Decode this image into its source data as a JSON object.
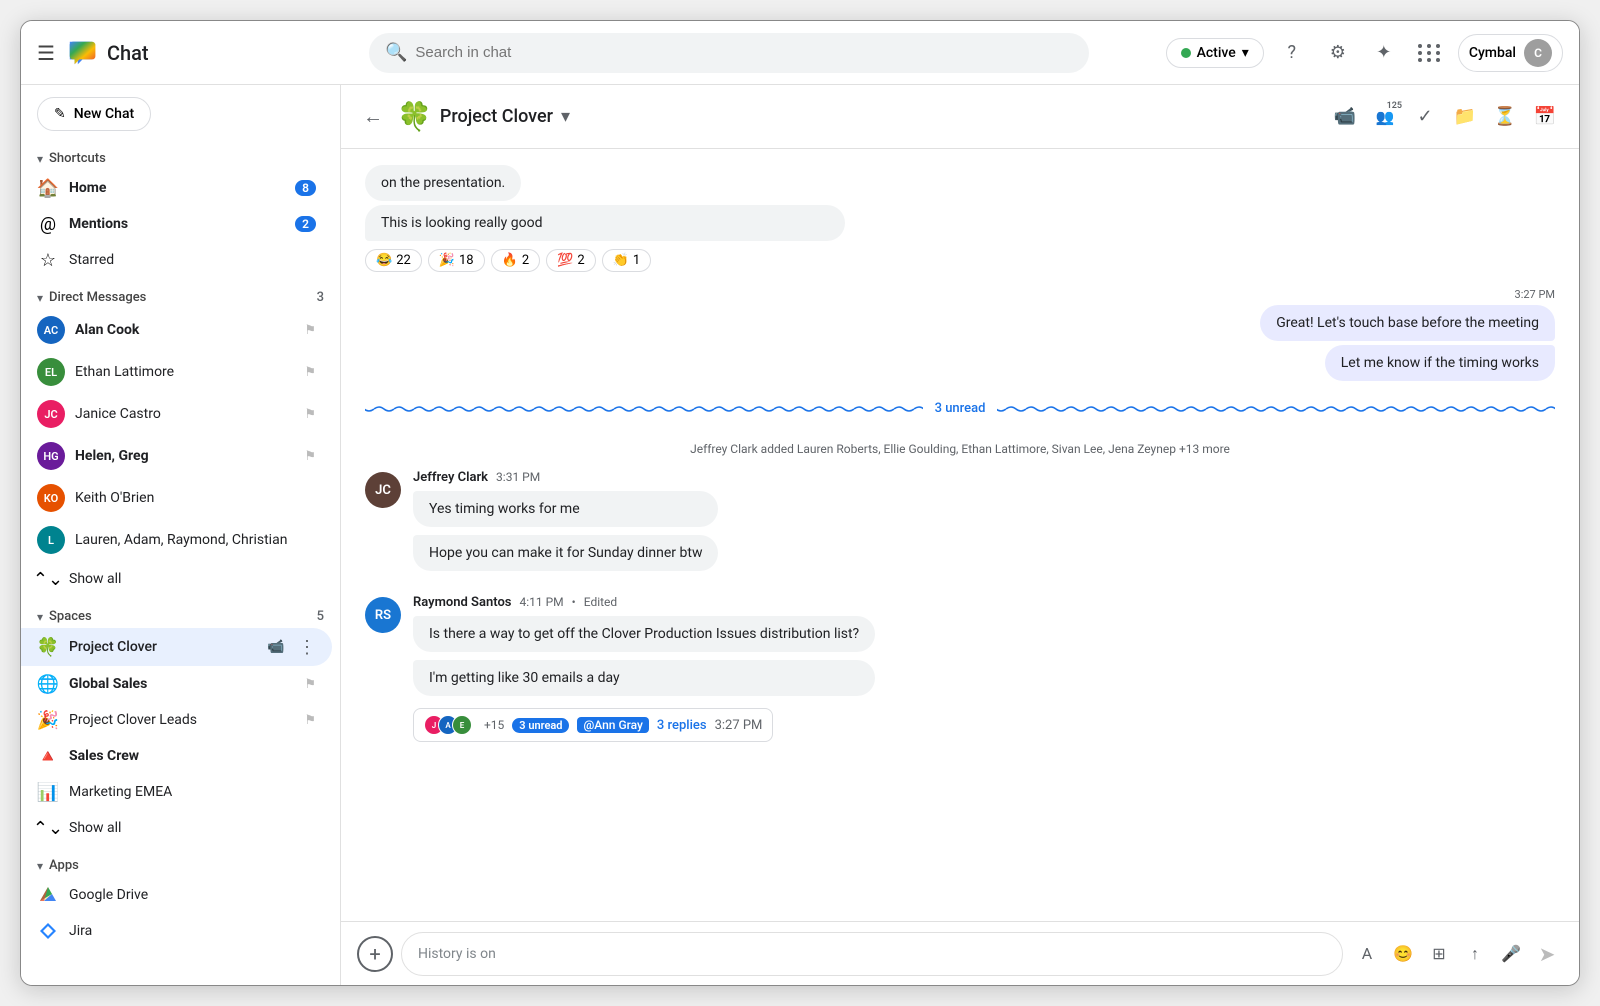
{
  "app": {
    "title": "Chat",
    "search_placeholder": "Search in chat"
  },
  "topbar": {
    "active_label": "Active",
    "user_name": "Cymbal"
  },
  "sidebar": {
    "new_chat_label": "New Chat",
    "shortcuts_label": "Shortcuts",
    "home_label": "Home",
    "home_badge": "8",
    "mentions_label": "Mentions",
    "mentions_badge": "2",
    "starred_label": "Starred",
    "dm_section": "Direct Messages",
    "dm_count": "3",
    "dm_items": [
      {
        "label": "Alan Cook",
        "bold": true,
        "avatar_initials": "AC",
        "avatar_class": "avatar-al"
      },
      {
        "label": "Ethan Lattimore",
        "bold": false,
        "avatar_initials": "EL",
        "avatar_class": "avatar-el"
      },
      {
        "label": "Janice Castro",
        "bold": false,
        "avatar_initials": "JC",
        "avatar_class": "avatar-jc"
      },
      {
        "label": "Helen, Greg",
        "bold": true,
        "avatar_initials": "HG",
        "avatar_class": "avatar-hg"
      },
      {
        "label": "Keith O'Brien",
        "bold": false,
        "avatar_initials": "KO",
        "avatar_class": "avatar-ko"
      },
      {
        "label": "Lauren, Adam, Raymond, Christian",
        "bold": false,
        "avatar_initials": "L",
        "avatar_class": "avatar-la"
      }
    ],
    "show_all_dm": "Show all",
    "spaces_section": "Spaces",
    "spaces_count": "5",
    "spaces_items": [
      {
        "label": "Project Clover",
        "active": true,
        "emoji": "🍀",
        "avatar_class": "avatar-pc"
      },
      {
        "label": "Global Sales",
        "bold": true,
        "emoji": "🌐",
        "avatar_class": "avatar-gs"
      },
      {
        "label": "Project Clover Leads",
        "bold": false,
        "emoji": "🎉",
        "avatar_class": "avatar-pc"
      },
      {
        "label": "Sales Crew",
        "bold": false,
        "emoji": "🔺",
        "avatar_class": ""
      },
      {
        "label": "Marketing EMEA",
        "bold": false,
        "emoji": "📊",
        "avatar_class": ""
      }
    ],
    "show_all_spaces": "Show all",
    "apps_section": "Apps",
    "app_items": [
      {
        "label": "Google Drive",
        "emoji": "📁"
      },
      {
        "label": "Jira",
        "emoji": "💠"
      }
    ]
  },
  "chat_header": {
    "space_name": "Project Clover",
    "back_label": "←",
    "members_count": "125"
  },
  "messages": {
    "partial_text": "on the presentation.",
    "msg1_text": "This is looking really good",
    "reactions": [
      {
        "emoji": "😂",
        "count": "22"
      },
      {
        "emoji": "🎉",
        "count": "18"
      },
      {
        "emoji": "🔥",
        "count": "2"
      },
      {
        "emoji": "💯",
        "count": "2"
      },
      {
        "emoji": "👏",
        "count": "1"
      }
    ],
    "out_time": "3:27 PM",
    "out_msg1": "Great! Let's touch base before the meeting",
    "out_msg2": "Let me know if the timing works",
    "unread_label": "3 unread",
    "system_msg": "Jeffrey Clark added Lauren Roberts, Ellie Goulding, Ethan Lattimore, Sivan Lee, Jena Zeynep +13 more",
    "jeffrey": {
      "name": "Jeffrey Clark",
      "time": "3:31 PM",
      "msg1": "Yes timing works for me",
      "msg2": "Hope you can make it for Sunday dinner btw",
      "initials": "JC2",
      "avatar_class": "avatar-jf"
    },
    "raymond": {
      "name": "Raymond Santos",
      "time": "4:11 PM",
      "edited": "Edited",
      "msg1": "Is there a way to get off the Clover Production Issues distribution list?",
      "msg2": "I'm getting like 30 emails a day",
      "initials": "RS",
      "avatar_class": "avatar-rs",
      "thread": {
        "unread_count": "3 unread",
        "mention": "@Ann Gray",
        "replies": "3 replies",
        "time": "3:27 PM",
        "plus": "+15"
      }
    }
  },
  "input": {
    "placeholder": "History is on"
  }
}
